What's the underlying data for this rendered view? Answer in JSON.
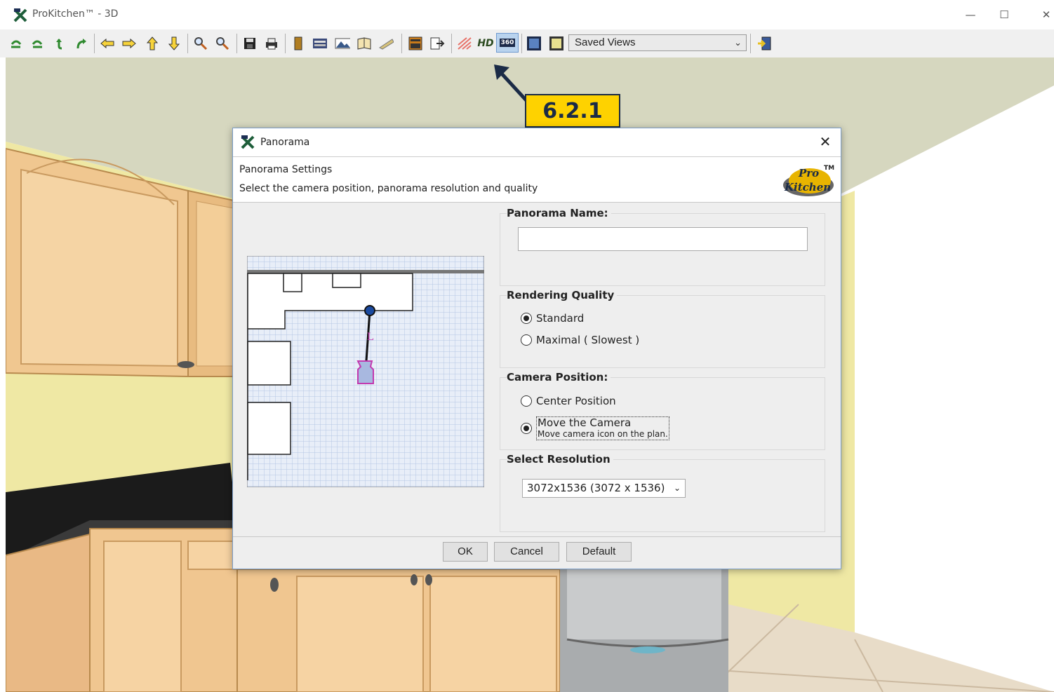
{
  "window": {
    "title": "ProKitchen™ - 3D",
    "minimize_icon": "minimize-icon",
    "maximize_icon": "maximize-icon",
    "close_icon": "close-icon"
  },
  "toolbar": {
    "saved_views_value": "Saved Views",
    "icons": [
      "undo-icon",
      "redo-icon",
      "rotate-left-icon",
      "rotate-right-icon",
      "arrow-left-icon",
      "arrow-right-icon",
      "arrow-up-icon",
      "arrow-down-icon",
      "zoom-in-icon",
      "zoom-out-icon",
      "save-icon",
      "print-icon",
      "door-icon",
      "render-icon",
      "landscape-icon",
      "book-icon",
      "surface-icon",
      "cabinet-icon",
      "export-icon",
      "lighting-icon",
      "hd-icon",
      "panorama-360-icon",
      "view-frame-icon",
      "view-frame-alt-icon",
      "exit-icon"
    ],
    "hd_label": "HD",
    "pano_label": "360"
  },
  "callout": {
    "label": "6.2.1"
  },
  "dialog": {
    "title": "Panorama",
    "header_title": "Panorama Settings",
    "header_subtitle": "Select the camera position, panorama resolution and quality",
    "logo_text_top": "Pro",
    "logo_text_bottom": "Kitchen",
    "logo_tm": "TM",
    "plan_camera_label": "L",
    "panorama_name_label": "Panorama Name:",
    "panorama_name_value": "",
    "rendering_quality_label": "Rendering Quality",
    "quality_options": [
      {
        "label": "Standard",
        "selected": true
      },
      {
        "label": "Maximal ( Slowest )",
        "selected": false
      }
    ],
    "camera_position_label": "Camera Position:",
    "camera_options": [
      {
        "label": "Center Position",
        "selected": false
      },
      {
        "label": "Move the Camera",
        "note": "Move camera icon on the plan.",
        "selected": true
      }
    ],
    "resolution_label": "Select Resolution",
    "resolution_value": "3072x1536 (3072 x 1536)",
    "buttons": {
      "ok": "OK",
      "cancel": "Cancel",
      "default": "Default"
    }
  }
}
